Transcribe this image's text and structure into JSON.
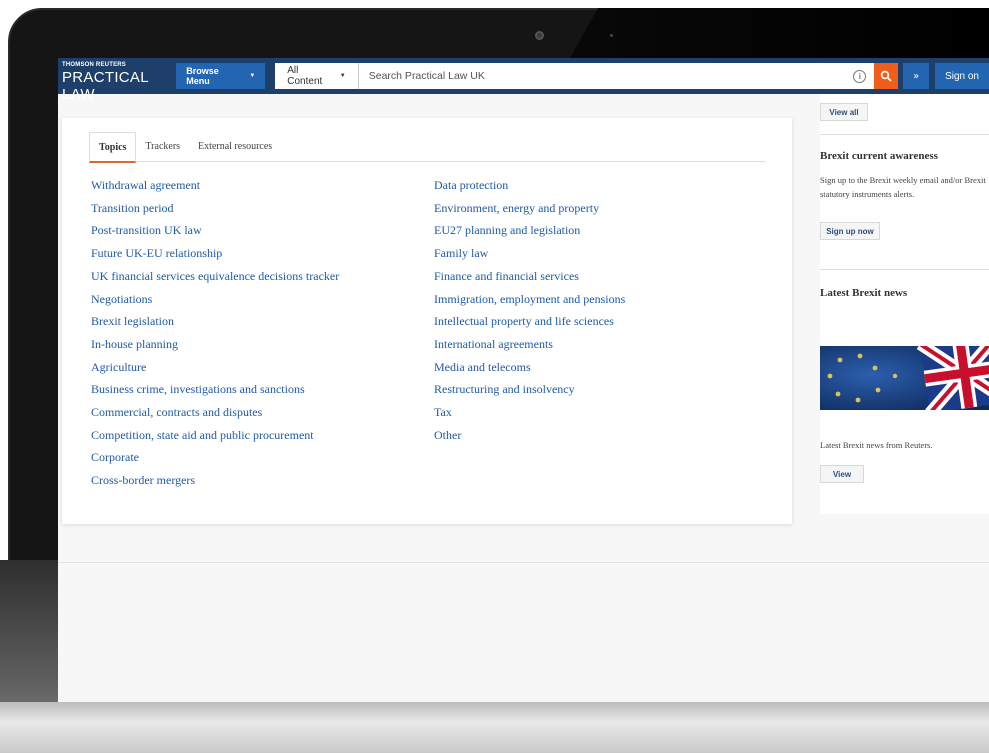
{
  "header": {
    "brand_small": "THOMSON REUTERS",
    "brand_main": "PRACTICAL LAW",
    "browse_menu_label": "Browse Menu",
    "content_filter_label": "All Content",
    "search_placeholder": "Search Practical Law UK",
    "sign_on_label": "Sign on"
  },
  "tabs": [
    {
      "label": "Topics",
      "active": true
    },
    {
      "label": "Trackers",
      "active": false
    },
    {
      "label": "External resources",
      "active": false
    }
  ],
  "topics_left": [
    "Withdrawal agreement",
    "Transition period",
    "Post-transition UK law",
    "Future UK-EU relationship",
    "UK financial services equivalence decisions tracker",
    "Negotiations",
    "Brexit legislation",
    "In-house planning",
    "Agriculture",
    "Business crime, investigations and sanctions",
    "Commercial, contracts and disputes",
    "Competition, state aid and public procurement",
    "Corporate",
    "Cross-border mergers"
  ],
  "topics_right": [
    "Data protection",
    "Environment, energy and property",
    "EU27 planning and legislation",
    "Family law",
    "Finance and financial services",
    "Immigration, employment and pensions",
    "Intellectual property and life sciences",
    "International agreements",
    "Media and telecoms",
    "Restructuring and insolvency",
    "Tax",
    "Other"
  ],
  "sidebar": {
    "view_all_label": "View all",
    "awareness_heading": "Brexit current awareness",
    "awareness_text": "Sign up to the Brexit weekly email and/or Brexit statutory instruments alerts.",
    "sign_up_label": "Sign up now",
    "news_heading": "Latest Brexit news",
    "news_text": "Latest Brexit news from Reuters.",
    "view_label": "View"
  },
  "colors": {
    "header_bg": "#1d3f6a",
    "button_blue": "#2465b2",
    "search_orange": "#f25d1c",
    "link_blue": "#1f5aa8",
    "tab_accent": "#e0662b"
  }
}
